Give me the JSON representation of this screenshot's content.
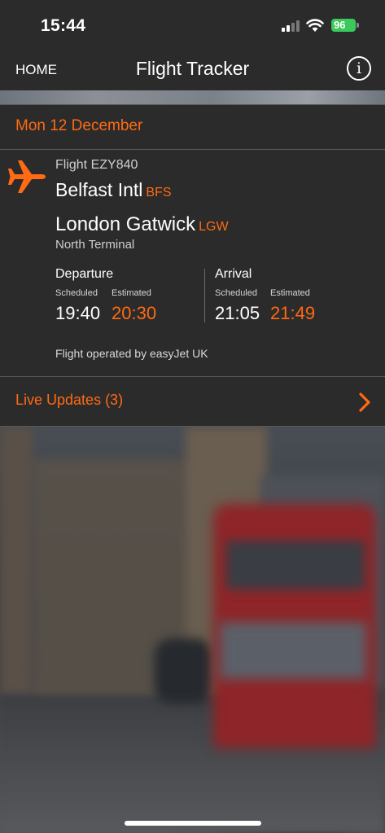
{
  "status_bar": {
    "time": "15:44",
    "battery": "96"
  },
  "nav": {
    "home_label": "HOME",
    "title": "Flight Tracker",
    "info_icon": "i"
  },
  "date": "Mon 12 December",
  "flight": {
    "number": "Flight EZY840",
    "origin_name": "Belfast Intl",
    "origin_code": "BFS",
    "destination_name": "London Gatwick",
    "destination_code": "LGW",
    "terminal": "North Terminal",
    "departure": {
      "label": "Departure",
      "scheduled_label": "Scheduled",
      "estimated_label": "Estimated",
      "scheduled": "19:40",
      "estimated": "20:30"
    },
    "arrival": {
      "label": "Arrival",
      "scheduled_label": "Scheduled",
      "estimated_label": "Estimated",
      "scheduled": "21:05",
      "estimated": "21:49"
    },
    "operator": "Flight operated by easyJet UK"
  },
  "live_updates": {
    "label": "Live Updates (3)"
  },
  "colors": {
    "accent": "#ff6a13",
    "background": "#2b2b2b",
    "battery": "#3ac95b"
  },
  "icons": {
    "plane": "airplane-icon",
    "chevron": "chevron-right-icon",
    "info": "info-icon"
  }
}
